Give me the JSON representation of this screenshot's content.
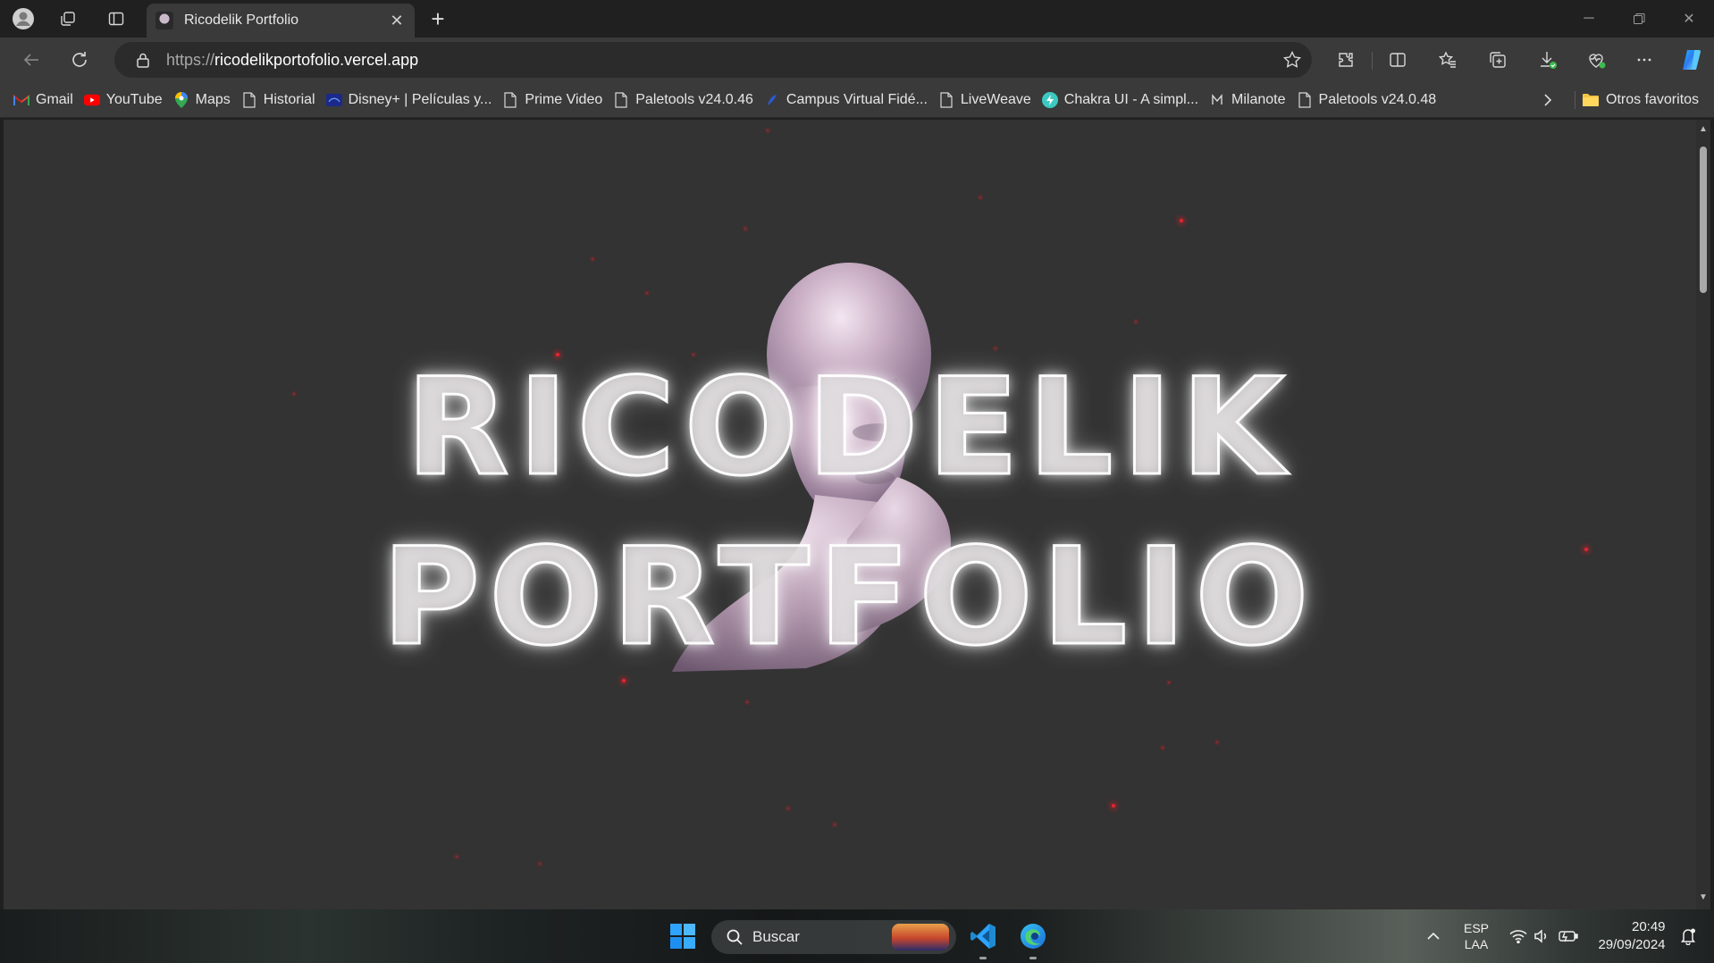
{
  "browser": {
    "tab": {
      "title": "Ricodelik Portfolio"
    },
    "address": {
      "scheme": "https://",
      "host": "ricodelikportofolio.vercel.app"
    },
    "bookmarks": [
      {
        "label": "Gmail",
        "icon": "gmail-icon"
      },
      {
        "label": "YouTube",
        "icon": "youtube-icon"
      },
      {
        "label": "Maps",
        "icon": "maps-icon"
      },
      {
        "label": "Historial",
        "icon": "page-icon"
      },
      {
        "label": "Disney+ | Películas y...",
        "icon": "disney-icon"
      },
      {
        "label": "Prime Video",
        "icon": "page-icon"
      },
      {
        "label": "Paletools v24.0.46",
        "icon": "page-icon"
      },
      {
        "label": "Campus Virtual Fidé...",
        "icon": "campus-icon"
      },
      {
        "label": "LiveWeave",
        "icon": "page-icon"
      },
      {
        "label": "Chakra UI - A simpl...",
        "icon": "chakra-icon"
      },
      {
        "label": "Milanote",
        "icon": "milanote-icon"
      },
      {
        "label": "Paletools v24.0.48",
        "icon": "page-icon"
      }
    ],
    "other_favorites": "Otros favoritos"
  },
  "page": {
    "hero_line1": "RICODELIK",
    "hero_line2": "PORTFOLIO",
    "accent_color": "#e0262f",
    "background_color": "#333333"
  },
  "taskbar": {
    "search_label": "Buscar",
    "lang_primary": "ESP",
    "lang_secondary": "LAA",
    "time": "20:49",
    "date": "29/09/2024"
  }
}
